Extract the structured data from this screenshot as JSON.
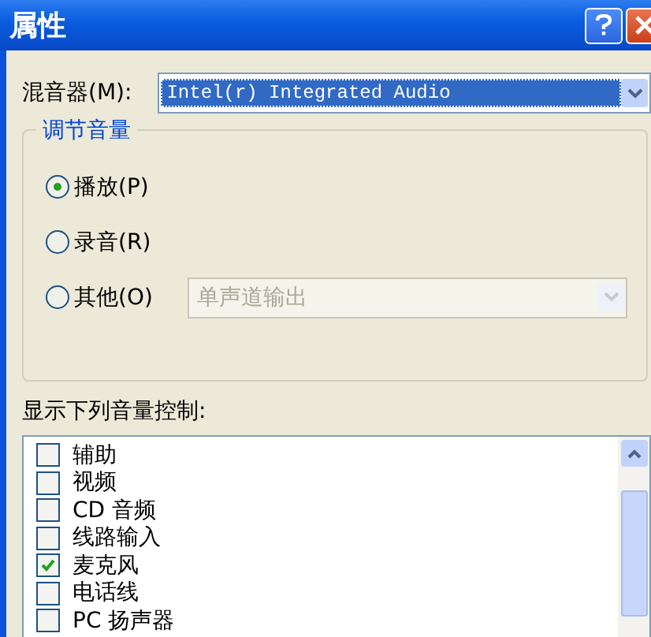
{
  "window": {
    "title": "属性"
  },
  "mixer": {
    "label": "混音器(M):",
    "value": "Intel(r) Integrated Audio"
  },
  "volume_group": {
    "legend": "调节音量",
    "options": [
      {
        "label": "播放(P)",
        "selected": true
      },
      {
        "label": "录音(R)",
        "selected": false
      },
      {
        "label": "其他(O)",
        "selected": false,
        "dropdown": {
          "value": "单声道输出",
          "disabled": true
        }
      }
    ]
  },
  "controls": {
    "label": "显示下列音量控制:",
    "items": [
      {
        "label": "辅助",
        "checked": false
      },
      {
        "label": "视频",
        "checked": false
      },
      {
        "label": "CD 音频",
        "checked": false
      },
      {
        "label": "线路输入",
        "checked": false
      },
      {
        "label": "麦克风",
        "checked": true
      },
      {
        "label": "电话线",
        "checked": false
      },
      {
        "label": "PC 扬声器",
        "checked": false
      }
    ]
  }
}
